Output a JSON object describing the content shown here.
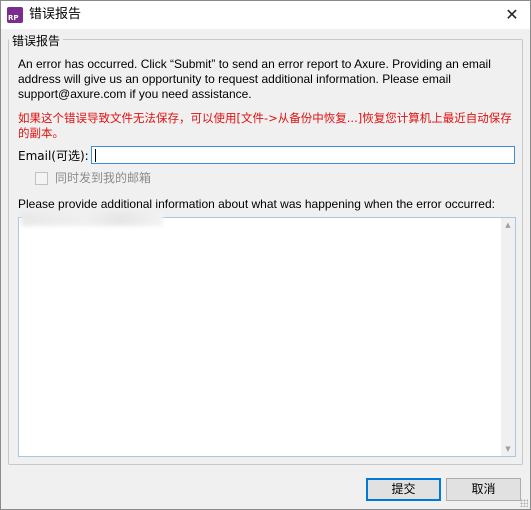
{
  "window": {
    "title": "错误报告",
    "app_icon_text": "RP",
    "close_label": "✕"
  },
  "group": {
    "legend": "错误报告"
  },
  "intro_text": "An error has occurred. Click “Submit” to send an error report to Axure. Providing an email address will give us an opportunity to request additional information. Please email support@axure.com if you need assistance.",
  "warning_text": "如果这个错误导致文件无法保存，可以使用[文件->从备份中恢复...]恢复您计算机上最近自动保存的副本。",
  "email": {
    "label": "Email(可选):",
    "value": "",
    "placeholder": ""
  },
  "checkbox": {
    "label": "同时发到我的邮箱",
    "checked": false,
    "enabled": false
  },
  "info": {
    "label": "Please provide additional information about what was happening when the error occurred:",
    "value": ""
  },
  "scrollbar": {
    "up_icon": "▲",
    "down_icon": "▼"
  },
  "buttons": {
    "submit_label": "提交",
    "cancel_label": "取消"
  },
  "colors": {
    "warning": "#e01010",
    "focus_border": "#3c8fd6",
    "primary_button_border": "#0078d7",
    "app_icon_bg": "#7b2d8e"
  }
}
